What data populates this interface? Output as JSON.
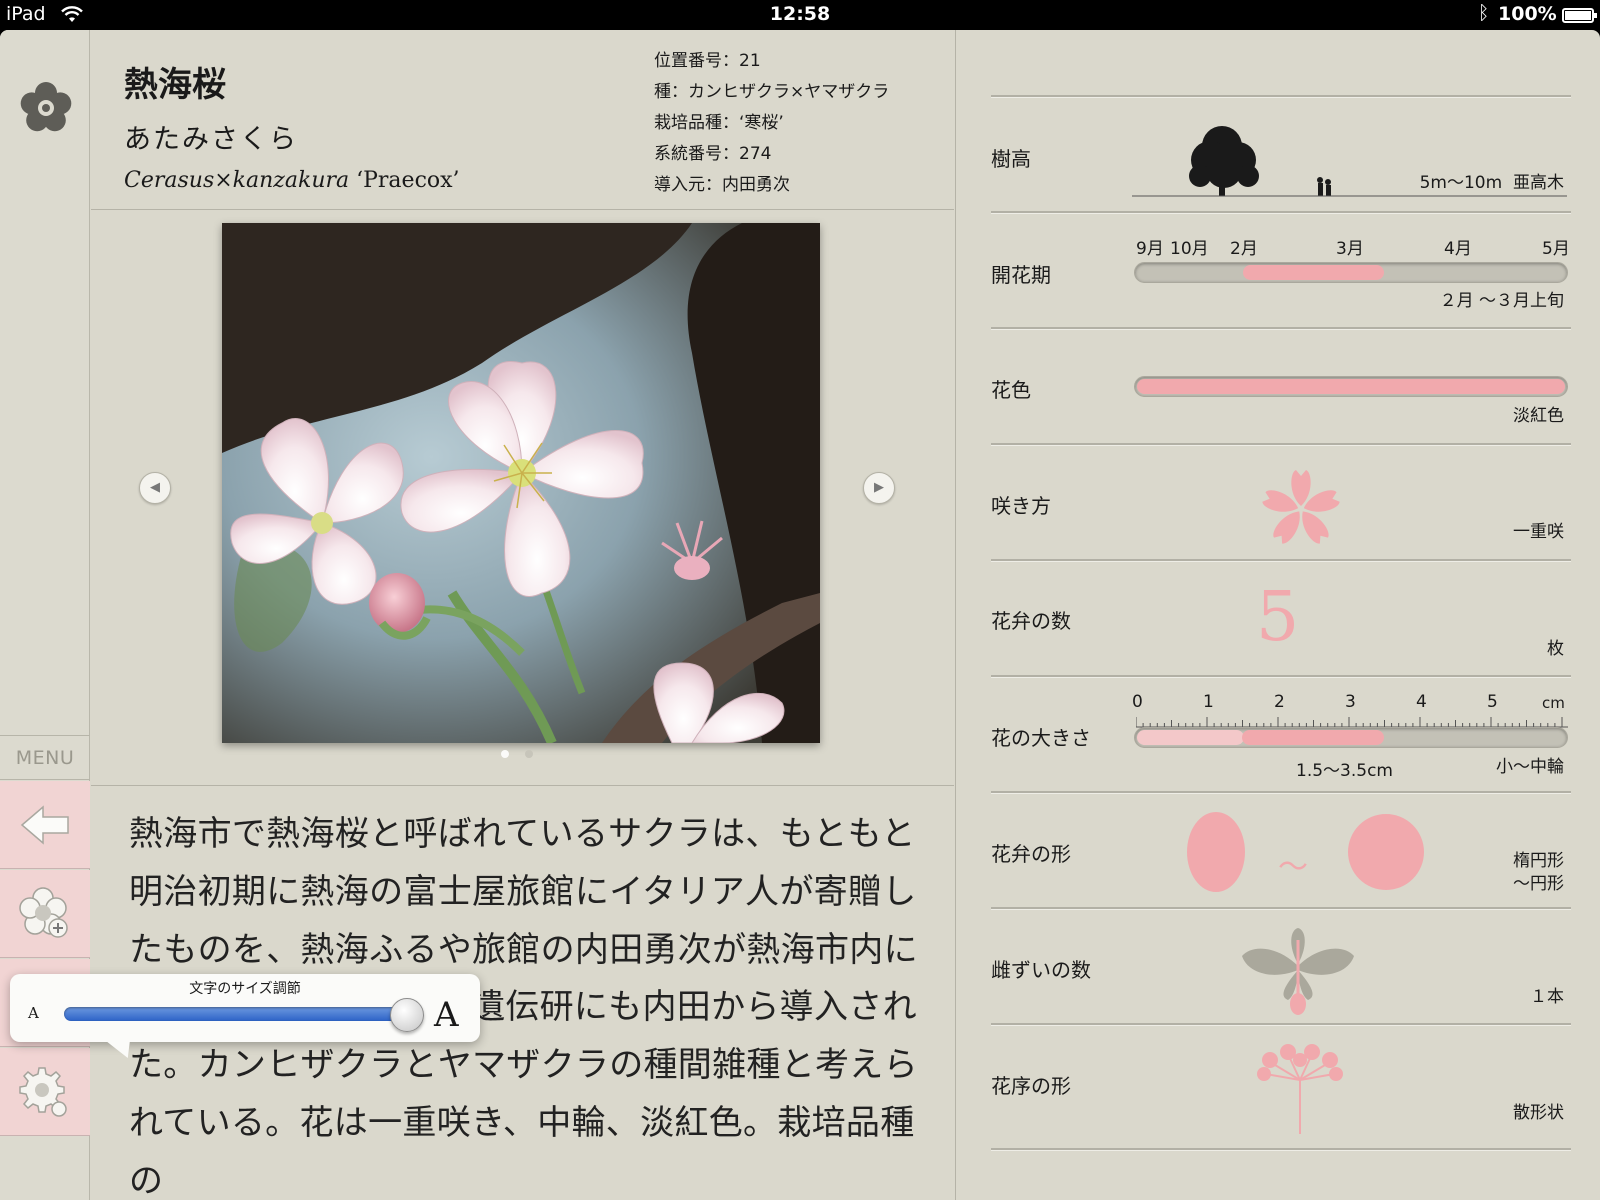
{
  "status": {
    "device": "iPad",
    "time": "12:58",
    "battery": "100%"
  },
  "sidebar": {
    "menu_label": "MENU"
  },
  "species": {
    "name": "熱海桜",
    "reading": "あたみさくら",
    "latin_italic": "Cerasus×kanzakura",
    "latin_cultivar": " ‘Praecox’",
    "meta": [
      "位置番号：21",
      "種：カンヒザクラ×ヤマザクラ",
      "栽培品種：‘寒桜’",
      "系統番号：274",
      "導入元：内田勇次"
    ]
  },
  "gallery": {
    "prev": "◀",
    "next": "▶",
    "page_count": 2,
    "current_page": 1
  },
  "description": "熱海市で熱海桜と呼ばれているサクラは、もともと明治初期に熱海の富士屋旅館にイタリア人が寄贈したものを、熱海ふるや旅館の内田勇次が熱海市内に広く栽培されている。遺伝研にも内田から導入された。カンヒザクラとヤマザクラの種間雑種と考えられている。花は一重咲き、中輪、淡紅色。栽培品種の",
  "font_popover": {
    "title": "文字のサイズ調節",
    "small": "A",
    "large": "A",
    "level": 1.0
  },
  "attributes": {
    "height": {
      "label": "樹高",
      "value": "5m〜10m",
      "class": "亜高木"
    },
    "bloom": {
      "label": "開花期",
      "months": [
        "9月",
        "10月",
        "2月",
        "3月",
        "4月",
        "5月"
      ],
      "value": "２月 〜３月上旬",
      "range_fraction": [
        0.25,
        0.58
      ]
    },
    "color": {
      "label": "花色",
      "value": "淡紅色",
      "swatch": "#f2a9ad"
    },
    "bloom_type": {
      "label": "咲き方",
      "value": "一重咲"
    },
    "petals": {
      "label": "花弁の数",
      "number": "5",
      "unit": "枚"
    },
    "size": {
      "label": "花の大きさ",
      "ticks": [
        "0",
        "1",
        "2",
        "3",
        "4",
        "5"
      ],
      "unit": "cm",
      "range": "1.5〜3.5cm",
      "class": "小〜中輪",
      "min_cm": 1.5,
      "max_cm": 3.5
    },
    "petal_shape": {
      "label": "花弁の形",
      "sep": "〜",
      "value_1": "楕円形",
      "value_2": "〜円形"
    },
    "pistil": {
      "label": "雌ずいの数",
      "value": "１本"
    },
    "inflorescence": {
      "label": "花序の形",
      "value": "散形状"
    }
  },
  "colors": {
    "accent_pink": "#f1a9ad",
    "background": "#dad8cc",
    "tool_pink": "#f1d4d3"
  }
}
